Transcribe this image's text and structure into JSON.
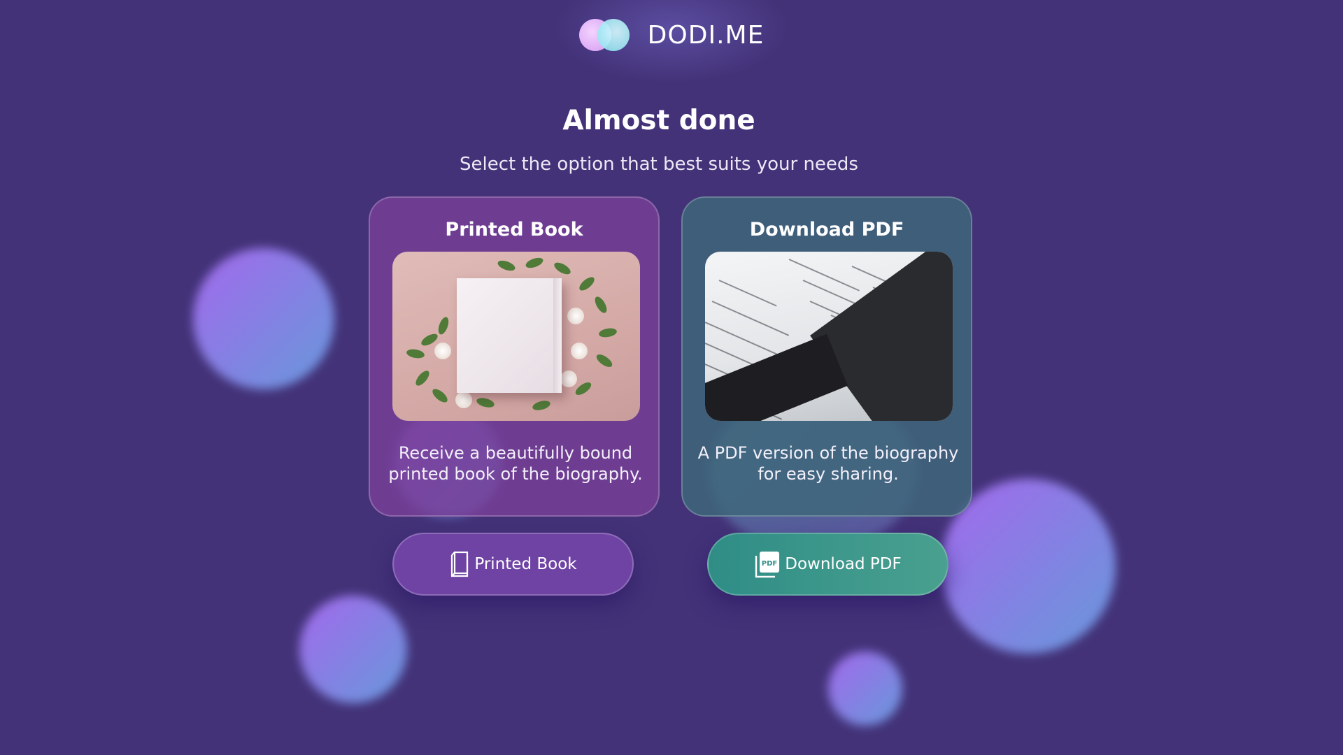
{
  "brand": {
    "name": "DODI.ME",
    "logo_icon": "dodi-logo-icon"
  },
  "header": {
    "title": "Almost done",
    "subtitle": "Select the option that best suits your needs"
  },
  "options": [
    {
      "id": "printed",
      "title": "Printed Book",
      "description": "Receive a beautifully bound printed book of the biography.",
      "button_label": "Printed Book",
      "button_icon": "book-icon",
      "image": "printed-book-photo",
      "accent": "#7b409a"
    },
    {
      "id": "pdf",
      "title": "Download PDF",
      "description": "A PDF version of the biography for easy sharing.",
      "button_label": "Download PDF",
      "button_icon": "pdf-file-icon",
      "image": "pdf-laptop-photo",
      "accent": "#3e687a"
    }
  ],
  "colors": {
    "background": "#433278",
    "print_button": "#6f43a4",
    "pdf_button": "#2f8d86"
  }
}
